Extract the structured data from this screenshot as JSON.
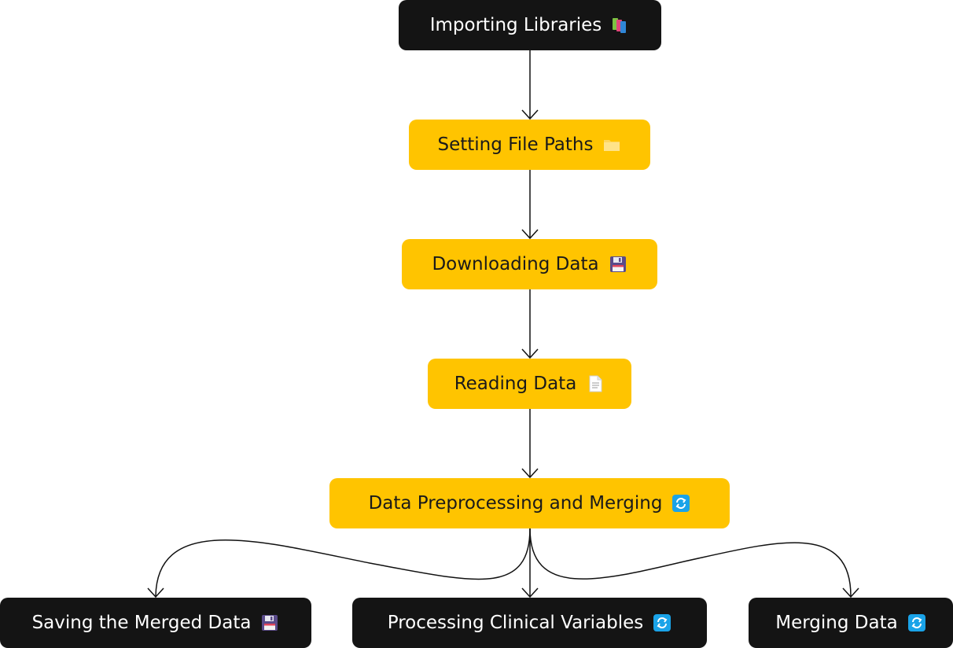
{
  "nodes": [
    {
      "id": "import",
      "label": "Importing Libraries",
      "icon": "books-icon",
      "style": "dark"
    },
    {
      "id": "paths",
      "label": "Setting File Paths",
      "icon": "folder-icon",
      "style": "yellow"
    },
    {
      "id": "download",
      "label": "Downloading Data",
      "icon": "floppy-disk-icon",
      "style": "yellow"
    },
    {
      "id": "read",
      "label": "Reading Data",
      "icon": "document-icon",
      "style": "yellow"
    },
    {
      "id": "preprocess",
      "label": "Data Preprocessing and Merging",
      "icon": "refresh-icon",
      "style": "yellow"
    },
    {
      "id": "save",
      "label": "Saving the Merged Data",
      "icon": "floppy-disk-icon",
      "style": "dark"
    },
    {
      "id": "clinical",
      "label": "Processing Clinical Variables",
      "icon": "refresh-icon",
      "style": "dark"
    },
    {
      "id": "merge",
      "label": "Merging Data",
      "icon": "refresh-icon",
      "style": "dark"
    }
  ],
  "edges": [
    {
      "from": "import",
      "to": "paths"
    },
    {
      "from": "paths",
      "to": "download"
    },
    {
      "from": "download",
      "to": "read"
    },
    {
      "from": "read",
      "to": "preprocess"
    },
    {
      "from": "preprocess",
      "to": "save"
    },
    {
      "from": "preprocess",
      "to": "clinical"
    },
    {
      "from": "preprocess",
      "to": "merge"
    }
  ],
  "colors": {
    "dark_node": "#141414",
    "yellow_node": "#ffc400",
    "edge": "#111111"
  }
}
